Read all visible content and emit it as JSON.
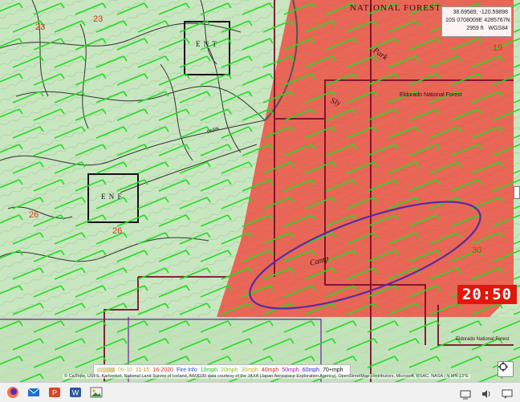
{
  "map": {
    "forest_label_top": "NATIONAL FOREST",
    "forest_label_mid": "Eldorado National Forest",
    "forest_label_bottom": "Eldorado National Forest",
    "sections": [
      "23",
      "23",
      "19",
      "26",
      "26",
      "30"
    ],
    "box_labels": [
      "E N T",
      "E N F"
    ],
    "place_labels": [
      "Sly",
      "Park",
      "Camp",
      "PARK"
    ],
    "colors": {
      "terrain": "#c8e6c0",
      "fire_area": "#ef4b3f",
      "wind_barbs": "#22dd22",
      "ellipse": "#5b2aa0",
      "contour": "#e47f6f"
    }
  },
  "coords": {
    "latlon": "38.69589, -120.59898",
    "utm": "10S 0708009E 4285767N",
    "elev": "2959 ft",
    "datum": "WGS84"
  },
  "clock": {
    "time": "20:50"
  },
  "legend": {
    "items": [
      {
        "label": "06-10",
        "color": "#c9b25a"
      },
      {
        "label": "11-15",
        "color": "#d88a1a"
      },
      {
        "label": "16-2020",
        "color": "#d7321f"
      },
      {
        "label": "Fire Info",
        "color": "#2c4bd6"
      },
      {
        "label": "10mph",
        "color": "#1fbf1f"
      },
      {
        "label": "20mph",
        "color": "#8ac51a"
      },
      {
        "label": "30mph",
        "color": "#c9b21a"
      },
      {
        "label": "40mph",
        "color": "#e0231a"
      },
      {
        "label": "50mph",
        "color": "#b31ab3"
      },
      {
        "label": "60mph",
        "color": "#3a1ad6"
      },
      {
        "label": "70+mph",
        "color": "#111111"
      }
    ]
  },
  "attribution": "© CalTopo, USFS, Kartverket, National Land Survey of Iceland, AW3D30 data courtesy of the JAXA (Japan Aerospace Exploration Agency), OpenStreetMap contributors, Microsoft, RSAC, NASA | N MN 13°E"
}
